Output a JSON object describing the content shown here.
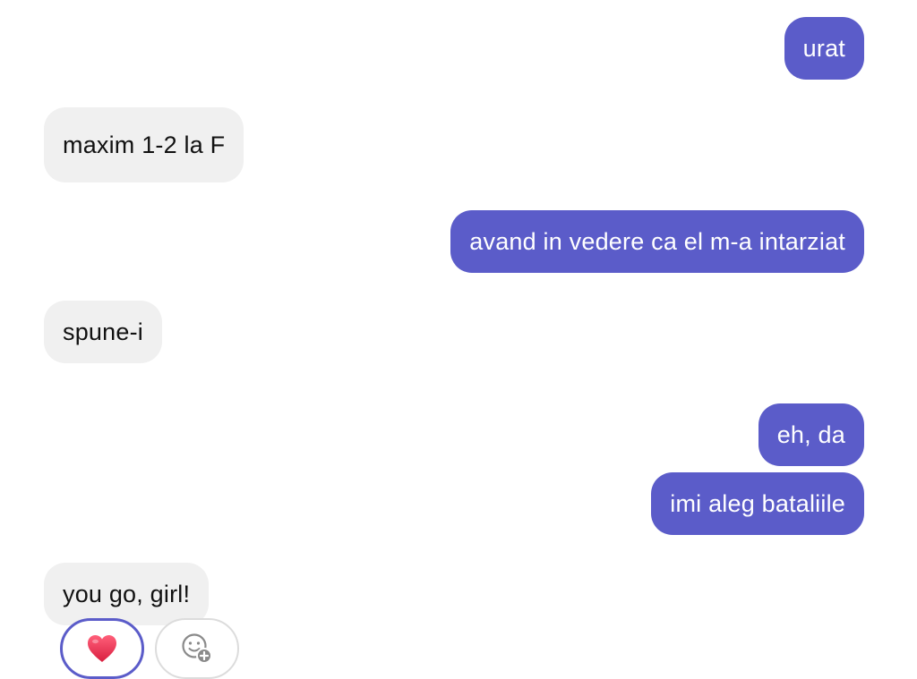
{
  "messages": [
    {
      "direction": "sent",
      "text": "urat"
    },
    {
      "direction": "received",
      "text": "maxim 1-2 la F"
    },
    {
      "direction": "sent",
      "text": "avand in vedere ca el m-a intarziat"
    },
    {
      "direction": "received",
      "text": "spune-i"
    },
    {
      "direction": "sent",
      "text": "eh, da"
    },
    {
      "direction": "sent",
      "text": "imi aleg bataliile"
    },
    {
      "direction": "received",
      "text": "you go, girl!"
    }
  ],
  "reactions": [
    {
      "icon": "heart-icon",
      "selected": true,
      "color": "#e8344e"
    },
    {
      "icon": "add-reaction-icon",
      "selected": false
    }
  ],
  "colors": {
    "sent_bubble": "#5b5cc9",
    "received_bubble": "#f0f0f0",
    "selected_outline": "#5b5cc9"
  }
}
